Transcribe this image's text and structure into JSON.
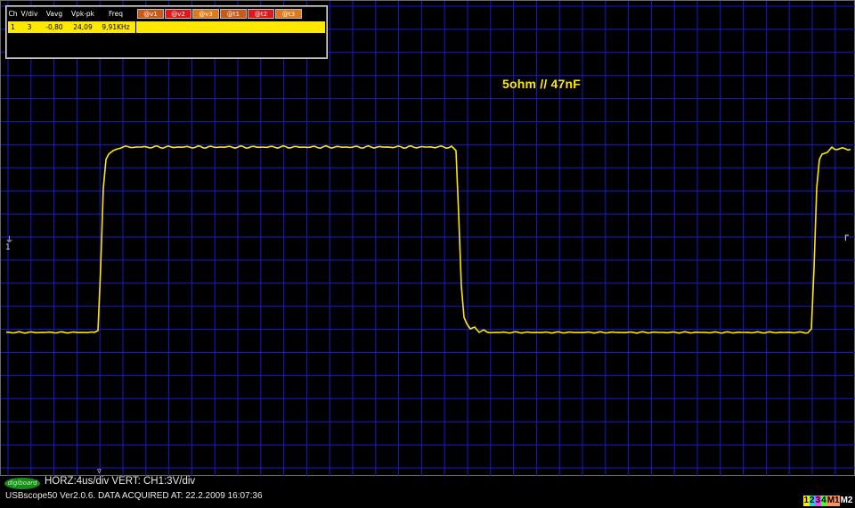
{
  "measurements": {
    "headers": [
      "Ch",
      "V/div",
      "Vavg",
      "Vpk-pk",
      "Freq"
    ],
    "row": [
      "1",
      "3",
      "-0,80",
      "24,09",
      "9,91KHz"
    ],
    "cursor_buttons": [
      {
        "label": "@v1",
        "color": "#c85a14"
      },
      {
        "label": "@v2",
        "color": "#e01818"
      },
      {
        "label": "@v3",
        "color": "#e07a18"
      },
      {
        "label": "@t1",
        "color": "#c85a14"
      },
      {
        "label": "@t2",
        "color": "#e01818"
      },
      {
        "label": "@t3",
        "color": "#e07a18"
      }
    ]
  },
  "annotation": "5ohm // 47nF",
  "trace": {
    "color": "#ffe800",
    "channel": "1"
  },
  "status": {
    "logo": "digiboard",
    "settings_line": "HORZ:4us/div VERT: CH1:3V/div",
    "acquired_line": "USBscope50 Ver2.0.6.  DATA ACQUIRED AT: 22.2.2009 16:07:36"
  },
  "channel_tabs": [
    {
      "label": "1",
      "color": "#ffe800"
    },
    {
      "label": "2",
      "color": "#00e0e0"
    },
    {
      "label": "3",
      "color": "#ff40ff"
    },
    {
      "label": "4",
      "color": "#40ff40"
    },
    {
      "label": "M1",
      "color": "#ff9060"
    },
    {
      "label": "M2",
      "color": "#ffffff"
    }
  ],
  "colors": {
    "grid": "#1a1acc",
    "background": "#000000"
  }
}
